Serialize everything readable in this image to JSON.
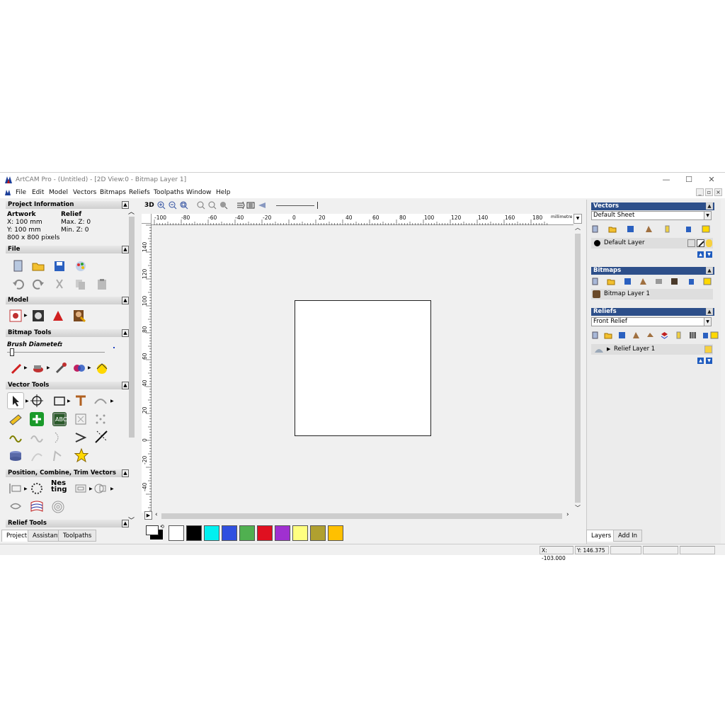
{
  "app": {
    "title": "ArtCAM Pro - (Untitled) - [2D View:0 - Bitmap Layer 1]",
    "window_controls": [
      "—",
      "☐",
      "✕"
    ],
    "mdi_controls": [
      "_",
      "▫",
      "×"
    ]
  },
  "menu": [
    "File",
    "Edit",
    "Model",
    "Vectors",
    "Bitmaps",
    "Reliefs",
    "Toolpaths",
    "Window",
    "Help"
  ],
  "left": {
    "project_info": {
      "title": "Project Information",
      "artwork_label": "Artwork",
      "relief_label": "Relief",
      "x": "X: 100 mm",
      "y": "Y: 100 mm",
      "pixels": "800 x 800 pixels",
      "maxz": "Max. Z: 0",
      "minz": "Min. Z: 0"
    },
    "file_title": "File",
    "model_title": "Model",
    "bitmap_tools": {
      "title": "Bitmap Tools",
      "brush_label": "Brush Diameter:",
      "brush_value": "5"
    },
    "vector_tools_title": "Vector Tools",
    "position_title": "Position, Combine, Trim Vectors",
    "relief_tools_title": "Relief Tools",
    "nesting_label": "Nes ting",
    "tabs": [
      "Project",
      "Assistant",
      "Toolpaths"
    ]
  },
  "toolbar": {
    "label_3d": "3D"
  },
  "ruler": {
    "h_labels": [
      "-100",
      "-80",
      "-60",
      "-40",
      "-20",
      "0",
      "20",
      "40",
      "60",
      "80",
      "100",
      "120",
      "140",
      "160",
      "180"
    ],
    "h_unit": "millimetres",
    "v_labels": [
      "140",
      "120",
      "100",
      "80",
      "60",
      "40",
      "20",
      "0",
      "-20",
      "-40"
    ]
  },
  "palette": {
    "colors": [
      "#ffffff",
      "#000000",
      "#00f0f0",
      "#3050e0",
      "#50b050",
      "#e01020",
      "#a030d0",
      "#ffff80",
      "#b0a030",
      "#ffc000"
    ]
  },
  "right": {
    "vectors": {
      "title": "Vectors",
      "sheet": "Default Sheet",
      "layer": "Default Layer"
    },
    "bitmaps": {
      "title": "Bitmaps",
      "layer": "Bitmap Layer 1"
    },
    "reliefs": {
      "title": "Reliefs",
      "relief": "Front Relief",
      "layer": "Relief Layer 1"
    },
    "tabs": [
      "Layers",
      "Add In"
    ]
  },
  "status": {
    "x": "X: -103.000",
    "y": "Y: 146.375"
  }
}
